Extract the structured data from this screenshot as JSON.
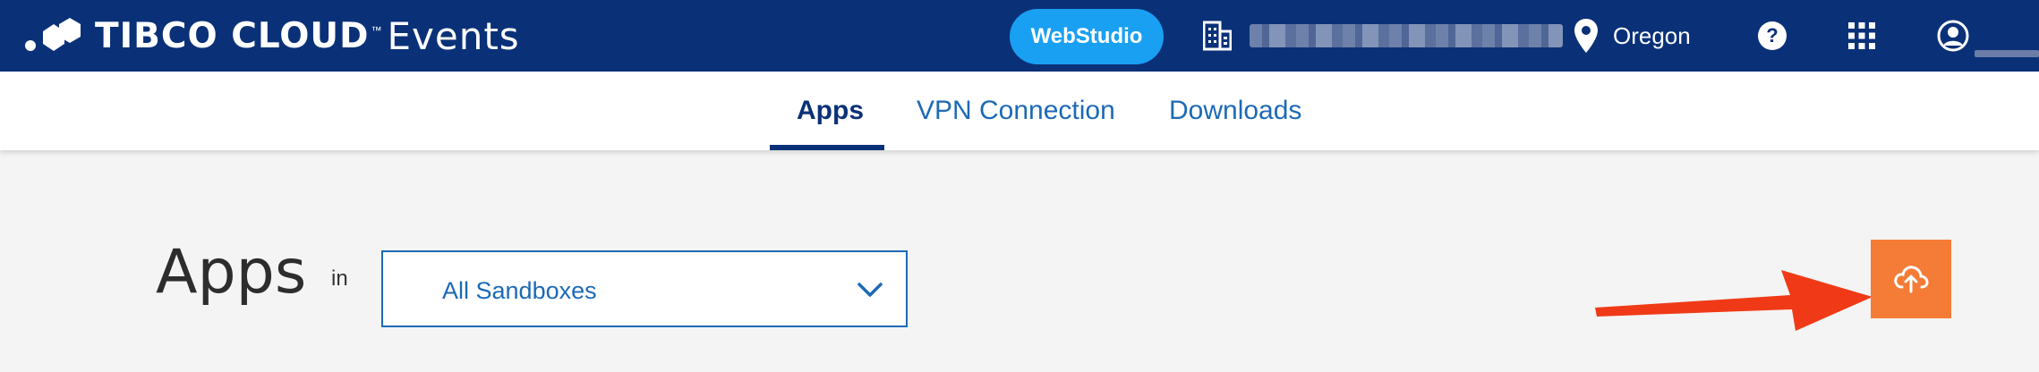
{
  "header": {
    "logo_brand": "TIBCO CLOUD",
    "logo_tm": "™",
    "logo_product": "Events",
    "webstudio_label": "WebStudio",
    "region_label": "Oregon",
    "help_symbol": "?"
  },
  "nav": {
    "tabs": [
      {
        "label": "Apps",
        "active": true
      },
      {
        "label": "VPN Connection",
        "active": false
      },
      {
        "label": "Downloads",
        "active": false
      }
    ]
  },
  "main": {
    "title": "Apps",
    "in_label": "in",
    "sandbox_select": {
      "value": "All Sandboxes"
    }
  },
  "colors": {
    "header_bg": "#0a3178",
    "webstudio_bg": "#1aa0f3",
    "link_blue": "#1c6ab5",
    "upload_orange": "#f57c36",
    "annotation_red": "#f03a17"
  },
  "icons": [
    "tibco-logo-icon",
    "building-icon",
    "location-pin-icon",
    "help-icon",
    "apps-grid-icon",
    "user-icon",
    "chevron-down-icon",
    "cloud-upload-icon"
  ]
}
